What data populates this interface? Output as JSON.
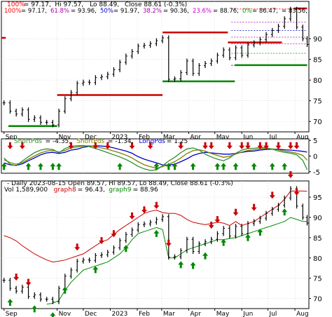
{
  "chart_data": [
    {
      "type": "line",
      "panel": "price-fibonacci",
      "header": [
        {
          "text": "100%",
          "color": "#ff0000"
        },
        {
          "text": "= 97.17,",
          "color": "#000000"
        },
        {
          "text": "Hi 97.57,",
          "color": "#000000"
        },
        {
          "text": "Lo 88.49,",
          "color": "#000000"
        },
        {
          "text": "Close 88.61 (-0.3%)",
          "color": "#000000"
        }
      ],
      "fib_legend": [
        {
          "label": "100%",
          "value": "97.17",
          "color": "#ff0000"
        },
        {
          "label": "61.8%",
          "value": "93.96",
          "color": "#aa00aa"
        },
        {
          "label": "50%",
          "value": "91.97",
          "color": "#0000cc"
        },
        {
          "label": "38.2%",
          "value": "90.36",
          "color": "#aa00aa"
        },
        {
          "label": "23.6%",
          "value": "88.76",
          "color": "#cc00cc"
        },
        {
          "label": "0%",
          "value": "86.47",
          "color": "#009900"
        },
        {
          "label": "",
          "value": "83.56",
          "color": "#000000"
        }
      ],
      "ylim": [
        67.5,
        99
      ],
      "y_ticks": [
        70,
        75,
        80,
        85,
        90
      ],
      "x_ticks": [
        "Sep",
        "Nov",
        "Dec",
        "2023",
        "Feb",
        "Mar",
        "Apr",
        "May",
        "Jun",
        "Jul",
        "Aug"
      ],
      "dates": [
        "2022-09-01",
        "2022-09-08",
        "2022-09-15",
        "2022-09-22",
        "2022-09-29",
        "2022-10-06",
        "2022-10-13",
        "2022-10-20",
        "2022-10-27",
        "2022-11-03",
        "2022-11-10",
        "2022-11-17",
        "2022-11-24",
        "2022-12-01",
        "2022-12-08",
        "2022-12-15",
        "2022-12-22",
        "2022-12-29",
        "2023-01-05",
        "2023-01-12",
        "2023-01-19",
        "2023-01-26",
        "2023-02-02",
        "2023-02-09",
        "2023-02-16",
        "2023-02-23",
        "2023-03-02",
        "2023-03-09",
        "2023-03-16",
        "2023-03-23",
        "2023-03-30",
        "2023-04-06",
        "2023-04-13",
        "2023-04-20",
        "2023-04-27",
        "2023-05-04",
        "2023-05-11",
        "2023-05-18",
        "2023-05-25",
        "2023-06-01",
        "2023-06-08",
        "2023-06-15",
        "2023-06-22",
        "2023-06-29",
        "2023-07-06",
        "2023-07-13",
        "2023-07-20",
        "2023-07-27",
        "2023-08-03",
        "2023-08-10",
        "2023-08-15"
      ],
      "close": [
        74.5,
        72.5,
        71.8,
        72.8,
        70.5,
        70.9,
        69.8,
        69.8,
        69.2,
        72.5,
        75.5,
        77.0,
        79.2,
        79.5,
        79.4,
        80.6,
        80.8,
        81.4,
        82.5,
        84.3,
        85.8,
        86.9,
        88.2,
        88.4,
        88.8,
        89.5,
        90.2,
        80.2,
        80.3,
        81.8,
        84.6,
        81.6,
        83.5,
        84.0,
        84.6,
        86.0,
        87.3,
        85.4,
        87.8,
        86.0,
        88.5,
        89.0,
        89.8,
        91.0,
        92.0,
        93.0,
        94.8,
        97.1,
        92.8,
        90.0,
        88.6
      ],
      "series": [
        {
          "name": "resistance",
          "color": "#cc0000",
          "segments": [
            [
              "2022-08-29",
              90.2,
              "2022-09-03",
              90.2
            ],
            [
              "2022-11-01",
              76.4,
              "2023-03-02",
              76.4
            ],
            [
              "2023-03-02",
              91.5,
              "2023-05-16",
              91.5
            ],
            [
              "2023-05-16",
              89.1,
              "2023-07-17",
              89.1
            ],
            [
              "2023-07-31",
              97.3,
              "2023-08-15",
              97.3
            ]
          ]
        },
        {
          "name": "support",
          "color": "#008800",
          "segments": [
            [
              "2022-09-06",
              68.9,
              "2022-11-01",
              68.9
            ],
            [
              "2023-03-02",
              79.7,
              "2023-05-24",
              79.7
            ],
            [
              "2023-05-24",
              83.6,
              "2023-08-15",
              83.6
            ]
          ]
        }
      ]
    },
    {
      "type": "line",
      "panel": "short-long-pds",
      "header": [
        {
          "text": "ShortPds",
          "color": "#2f8f2f"
        },
        {
          "text": "= -4.35,",
          "color": "#000000"
        },
        {
          "text": "ShortPds",
          "color": "#808000"
        },
        {
          "text": "= -1.34,",
          "color": "#000000"
        },
        {
          "text": "LongPds",
          "color": "#0000cc"
        },
        {
          "text": "= 1.25",
          "color": "#000000"
        }
      ],
      "ylim": [
        -5.5,
        5.5
      ],
      "y_ticks": [
        5,
        0,
        -5
      ],
      "series": [
        {
          "name": "LongPds",
          "color": "#0000cc",
          "values": [
            -2.2,
            -2.8,
            -3.0,
            -2.5,
            -1.5,
            -0.6,
            0.4,
            1.0,
            1.2,
            0.8,
            1.2,
            1.9,
            2.2,
            2.8,
            3.1,
            3.3,
            3.2,
            3.0,
            2.6,
            2.1,
            1.6,
            0.9,
            -0.2,
            -1.0,
            -1.6,
            -2.2,
            -2.8,
            -2.9,
            -2.6,
            -1.8,
            -0.9,
            0.2,
            0.8,
            1.2,
            1.0,
            0.8,
            0.6,
            0.6,
            0.8,
            1.2,
            1.5,
            1.6,
            1.9,
            2.1,
            2.2,
            2.2,
            2.0,
            1.9,
            1.7,
            1.5,
            1.25
          ]
        },
        {
          "name": "ShortPds",
          "color": "#808000",
          "values": [
            -1.2,
            -2.1,
            -2.6,
            -2.1,
            -1.0,
            0.0,
            1.0,
            1.6,
            1.8,
            1.3,
            1.8,
            2.6,
            2.9,
            3.2,
            3.3,
            3.0,
            2.6,
            2.2,
            1.6,
            1.0,
            0.3,
            -0.6,
            -1.8,
            -2.8,
            -3.4,
            -3.9,
            -3.4,
            -2.7,
            -1.8,
            -0.6,
            0.8,
            1.7,
            2.0,
            1.6,
            0.8,
            0.2,
            -0.4,
            -0.1,
            0.6,
            1.3,
            1.8,
            2.0,
            2.3,
            2.4,
            2.3,
            2.0,
            1.6,
            1.3,
            0.9,
            0.2,
            -1.34
          ]
        },
        {
          "name": "ShortPds",
          "color": "#2f8f2f",
          "values": [
            -0.6,
            -2.6,
            -3.1,
            -1.6,
            -0.2,
            1.1,
            1.9,
            2.3,
            2.1,
            1.0,
            2.4,
            3.1,
            3.3,
            3.4,
            3.0,
            2.4,
            1.8,
            1.1,
            0.4,
            -0.3,
            -1.1,
            -2.1,
            -3.3,
            -4.1,
            -4.6,
            -4.4,
            -3.1,
            -1.6,
            -0.4,
            1.1,
            2.3,
            2.6,
            1.9,
            0.6,
            -0.3,
            -1.0,
            -1.5,
            -0.6,
            0.9,
            1.9,
            2.4,
            2.5,
            2.7,
            2.6,
            2.2,
            1.6,
            1.2,
            0.9,
            0.4,
            -1.4,
            -4.35
          ]
        }
      ],
      "buy_signals": [
        "2022-09-01",
        "2022-09-29",
        "2022-10-13",
        "2022-10-27",
        "2022-11-03",
        "2023-01-12",
        "2023-02-23",
        "2023-03-09",
        "2023-03-16",
        "2023-04-06",
        "2023-05-04",
        "2023-05-11",
        "2023-05-25",
        "2023-06-15",
        "2023-07-06",
        "2023-07-20"
      ],
      "sell_signals": [
        "2022-09-08",
        "2022-09-22",
        "2022-11-17",
        "2022-12-15",
        "2022-12-29",
        "2023-01-26",
        "2023-02-16",
        "2023-03-23",
        "2023-04-20",
        "2023-04-27",
        "2023-05-18",
        "2023-06-01",
        "2023-06-08",
        "2023-06-22",
        "2023-06-29",
        "2023-07-13",
        "2023-07-27",
        "2023-08-03"
      ]
    },
    {
      "type": "line",
      "panel": "price-graphs",
      "header_line1": [
        {
          "text": "- Daily 2023-08-15 Open 89.57, Hi 89.57, Lo 88.49, Close 88.61 (-0.3%)",
          "color": "#000000"
        }
      ],
      "header_line2": [
        {
          "text": "Vol 1,589,900",
          "color": "#000000"
        },
        {
          "text": "graph8",
          "color": "#cc0000"
        },
        {
          "text": "= 96.43,",
          "color": "#000000"
        },
        {
          "text": "graph9",
          "color": "#008800"
        },
        {
          "text": "= 88.96",
          "color": "#000000"
        }
      ],
      "ylim": [
        67.5,
        99
      ],
      "y_ticks": [
        70,
        75,
        80,
        85,
        90,
        95
      ],
      "x_ticks": [
        "Sep",
        "Nov",
        "Dec",
        "2023",
        "Feb",
        "Mar",
        "Apr",
        "May",
        "Jun",
        "Jul",
        "Aug"
      ],
      "series": [
        {
          "name": "graph8",
          "color": "#cc0000",
          "values": [
            85.5,
            85.0,
            84.2,
            83.0,
            82.0,
            81.0,
            80.2,
            79.5,
            79.0,
            79.2,
            79.5,
            80.0,
            80.5,
            81.0,
            82.0,
            83.0,
            84.0,
            84.5,
            85.8,
            87.0,
            88.0,
            89.0,
            90.0,
            91.0,
            91.5,
            91.8,
            91.2,
            91.0,
            91.0,
            90.5,
            89.5,
            88.8,
            88.5,
            88.2,
            88.5,
            88.8,
            88.6,
            88.0,
            89.0,
            88.0,
            88.5,
            89.0,
            90.0,
            91.0,
            92.0,
            93.0,
            94.5,
            96.5,
            96.5,
            96.5,
            96.43
          ]
        },
        {
          "name": "graph9",
          "color": "#008800",
          "values": [
            null,
            null,
            null,
            null,
            null,
            null,
            null,
            68.6,
            68.8,
            69.5,
            72.0,
            74.0,
            75.5,
            77.0,
            77.5,
            78.0,
            78.5,
            79.0,
            80.0,
            81.0,
            82.5,
            84.5,
            86.0,
            86.5,
            87.0,
            87.5,
            87.0,
            80.0,
            80.0,
            81.0,
            82.0,
            82.5,
            83.0,
            83.5,
            84.0,
            84.5,
            84.5,
            84.8,
            85.0,
            85.5,
            86.0,
            86.5,
            87.0,
            87.5,
            88.0,
            88.5,
            89.0,
            90.0,
            89.5,
            89.0,
            88.96
          ]
        }
      ],
      "buy_signals": [
        "2022-09-08",
        "2022-10-06",
        "2022-10-27",
        "2022-11-10",
        "2022-12-15",
        "2023-01-19",
        "2023-02-23",
        "2023-03-23",
        "2023-04-06",
        "2023-04-20",
        "2023-05-11",
        "2023-06-08",
        "2023-06-22",
        "2023-07-20"
      ],
      "sell_signals": [
        "2022-09-15",
        "2022-09-29",
        "2022-11-24",
        "2022-12-22",
        "2023-01-05",
        "2023-01-26",
        "2023-02-09",
        "2023-02-23",
        "2023-03-09",
        "2023-04-27",
        "2023-05-04",
        "2023-05-25",
        "2023-06-15",
        "2023-07-06",
        "2023-07-27",
        "2023-08-03"
      ]
    }
  ]
}
